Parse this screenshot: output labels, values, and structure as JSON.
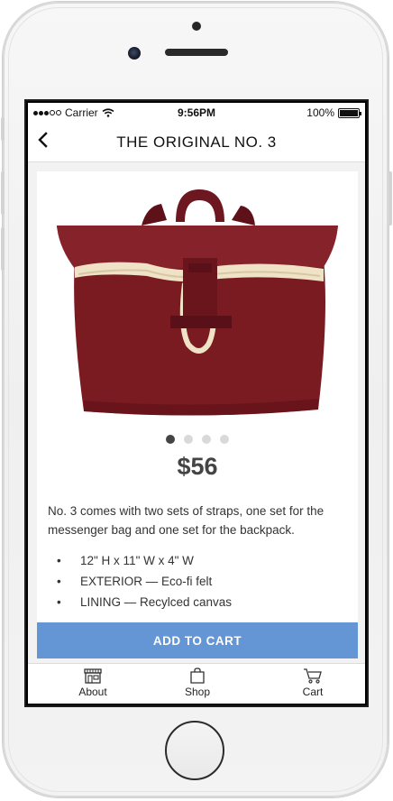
{
  "status_bar": {
    "carrier": "Carrier",
    "time": "9:56PM",
    "battery": "100%"
  },
  "navbar": {
    "back_icon": "chevron-left-icon",
    "title": "THE ORIGINAL NO. 3"
  },
  "product": {
    "image_icon": "backpack-image",
    "colors": {
      "bag": "#7a1b22",
      "trim": "#efe2c6"
    },
    "pager": {
      "count": 4,
      "active_index": 0
    },
    "price": "$56",
    "description": "No. 3 comes with two sets of straps, one set for the messenger bag and one set for the backpack.",
    "specs": [
      "12\" H x 11\" W x 4\" W",
      "EXTERIOR — Eco-fi felt",
      "LINING — Recylced canvas"
    ]
  },
  "cta": {
    "label": "ADD TO CART",
    "color": "#6495d4"
  },
  "tabs": [
    {
      "label": "About",
      "icon": "storefront-icon"
    },
    {
      "label": "Shop",
      "icon": "shopping-bag-icon"
    },
    {
      "label": "Cart",
      "icon": "cart-icon"
    }
  ]
}
